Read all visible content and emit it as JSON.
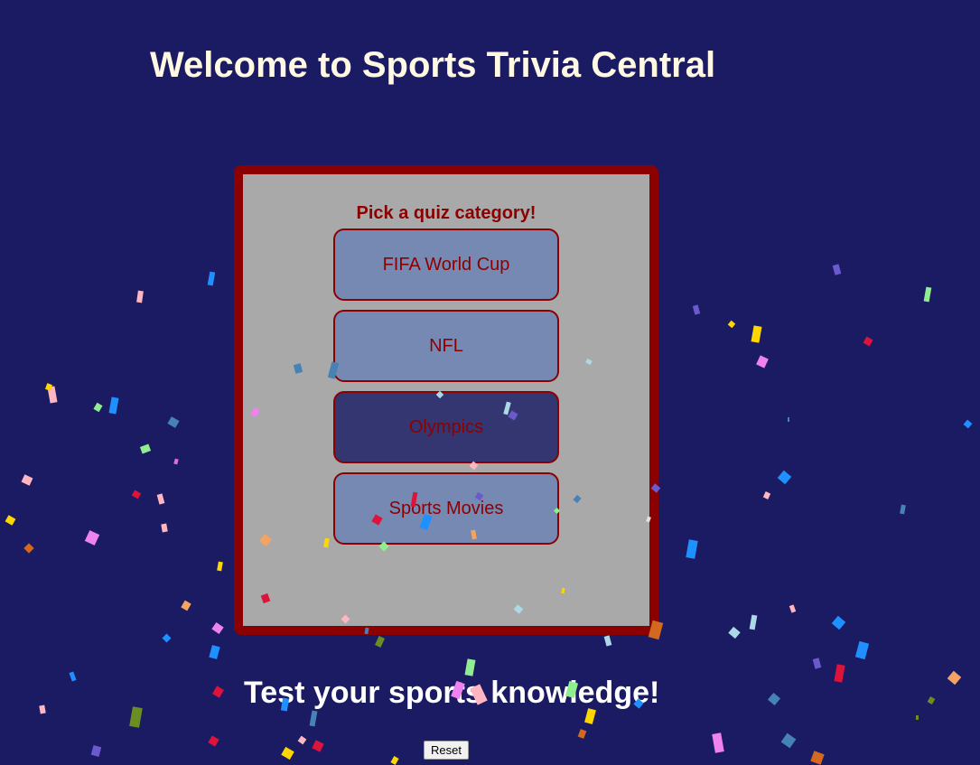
{
  "header": {
    "title": "Welcome to Sports Trivia Central"
  },
  "quiz": {
    "prompt": "Pick a quiz category!",
    "categories": [
      {
        "label": "FIFA World Cup"
      },
      {
        "label": "NFL"
      },
      {
        "label": "Olympics"
      },
      {
        "label": "Sports Movies"
      }
    ]
  },
  "footer": {
    "tagline": "Test your sports knowledge!",
    "reset_label": "Reset"
  },
  "colors": {
    "background": "#1b1b63",
    "panel_border": "#8b0000",
    "panel_fill": "#a9a9a9",
    "button_fill": "#7689b3",
    "button_active_fill": "#333670",
    "title_text": "#fff8e3"
  }
}
